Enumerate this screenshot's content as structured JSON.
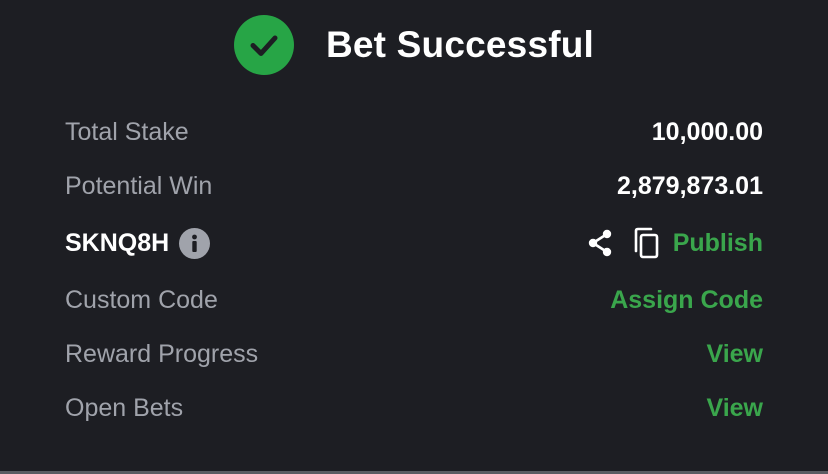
{
  "header": {
    "title": "Bet Successful"
  },
  "rows": {
    "total_stake": {
      "label": "Total Stake",
      "value": "10,000.00"
    },
    "potential_win": {
      "label": "Potential Win",
      "value": "2,879,873.01"
    },
    "booking_code": {
      "code": "SKNQ8H",
      "publish_label": "Publish"
    },
    "custom_code": {
      "label": "Custom Code",
      "action": "Assign Code"
    },
    "reward_progress": {
      "label": "Reward Progress",
      "action": "View"
    },
    "open_bets": {
      "label": "Open Bets",
      "action": "View"
    }
  },
  "icons": {
    "success": "checkmark-circle-icon",
    "info": "info-icon",
    "share": "share-icon",
    "copy": "copy-icon"
  },
  "colors": {
    "background": "#1d1e23",
    "success_green": "#27a546",
    "link_green": "#3aa64c",
    "muted_text": "#a0a3ab",
    "primary_text": "#ffffff"
  }
}
